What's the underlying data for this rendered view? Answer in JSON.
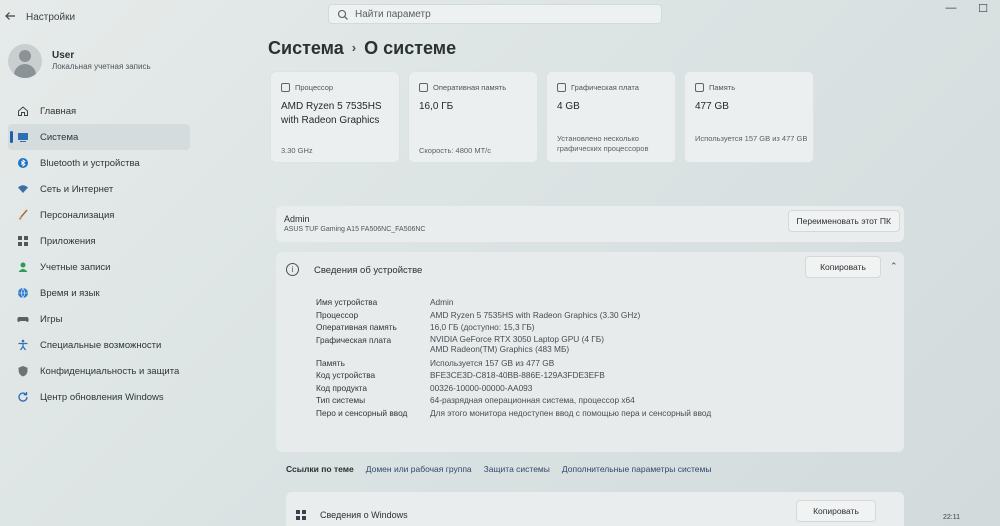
{
  "app": {
    "title": "Настройки"
  },
  "search": {
    "placeholder": "Найти параметр"
  },
  "user": {
    "name": "User",
    "account_type": "Локальная учетная запись"
  },
  "nav": {
    "items": [
      {
        "label": "Главная",
        "icon": "home-icon"
      },
      {
        "label": "Система",
        "icon": "system-icon",
        "active": true
      },
      {
        "label": "Bluetooth и устройства",
        "icon": "bluetooth-icon"
      },
      {
        "label": "Сеть и Интернет",
        "icon": "wifi-icon"
      },
      {
        "label": "Персонализация",
        "icon": "brush-icon"
      },
      {
        "label": "Приложения",
        "icon": "apps-icon"
      },
      {
        "label": "Учетные записи",
        "icon": "person-icon"
      },
      {
        "label": "Время и язык",
        "icon": "globe-icon"
      },
      {
        "label": "Игры",
        "icon": "gamepad-icon"
      },
      {
        "label": "Специальные возможности",
        "icon": "accessibility-icon"
      },
      {
        "label": "Конфиденциальность и защита",
        "icon": "shield-icon"
      },
      {
        "label": "Центр обновления Windows",
        "icon": "update-icon"
      }
    ]
  },
  "header": {
    "parent": "Система",
    "current": "О системе"
  },
  "cards": [
    {
      "label": "Процессор",
      "value": "AMD Ryzen 5 7535HS with Radeon Graphics",
      "note": "3.30 GHz"
    },
    {
      "label": "Оперативная память",
      "value": "16,0 ГБ",
      "note": "Скорость: 4800 МТ/с"
    },
    {
      "label": "Графическая плата",
      "value": "4 GB",
      "note": "Установлено несколько графических процессоров"
    },
    {
      "label": "Память",
      "value": "477 GB",
      "note": "Используется 157 GB из 477 GB"
    }
  ],
  "pc": {
    "name": "Admin",
    "model": "ASUS TUF Gaming A15 FA506NC_FA506NC",
    "rename_label": "Переименовать этот ПК"
  },
  "specs": {
    "title": "Сведения об устройстве",
    "copy_label": "Копировать",
    "rows": [
      {
        "key": "Имя устройства",
        "value": "Admin"
      },
      {
        "key": "Процессор",
        "value": "AMD Ryzen 5 7535HS with Radeon Graphics (3.30 GHz)"
      },
      {
        "key": "Оперативная память",
        "value": "16,0 ГБ (доступно: 15,3 ГБ)"
      },
      {
        "key": "Графическая плата",
        "value": "NVIDIA GeForce RTX 3050 Laptop GPU (4 ГБ)",
        "value2": "AMD Radeon(TM) Graphics (483 МБ)"
      },
      {
        "key": "Память",
        "value": "Используется 157 GB из 477 GB"
      },
      {
        "key": "Код устройства",
        "value": "BFE3CE3D-C818-40BB-886E-129A3FDE3EFB"
      },
      {
        "key": "Код продукта",
        "value": "00326-10000-00000-AA093"
      },
      {
        "key": "Тип системы",
        "value": "64-разрядная операционная система, процессор x64"
      },
      {
        "key": "Перо и сенсорный ввод",
        "value": "Для этого монитора недоступен ввод с помощью пера и сенсорный ввод"
      }
    ]
  },
  "related": {
    "label": "Ссылки по теме",
    "links": [
      "Домен или рабочая группа",
      "Защита системы",
      "Дополнительные параметры системы"
    ]
  },
  "windows_specs": {
    "title": "Сведения о Windows",
    "copy_label": "Копировать"
  },
  "taskbar": {
    "time": "22:11"
  },
  "colors": {
    "accent": "#1f5fae",
    "background": "#dde4e4",
    "card": "#ebefef"
  }
}
